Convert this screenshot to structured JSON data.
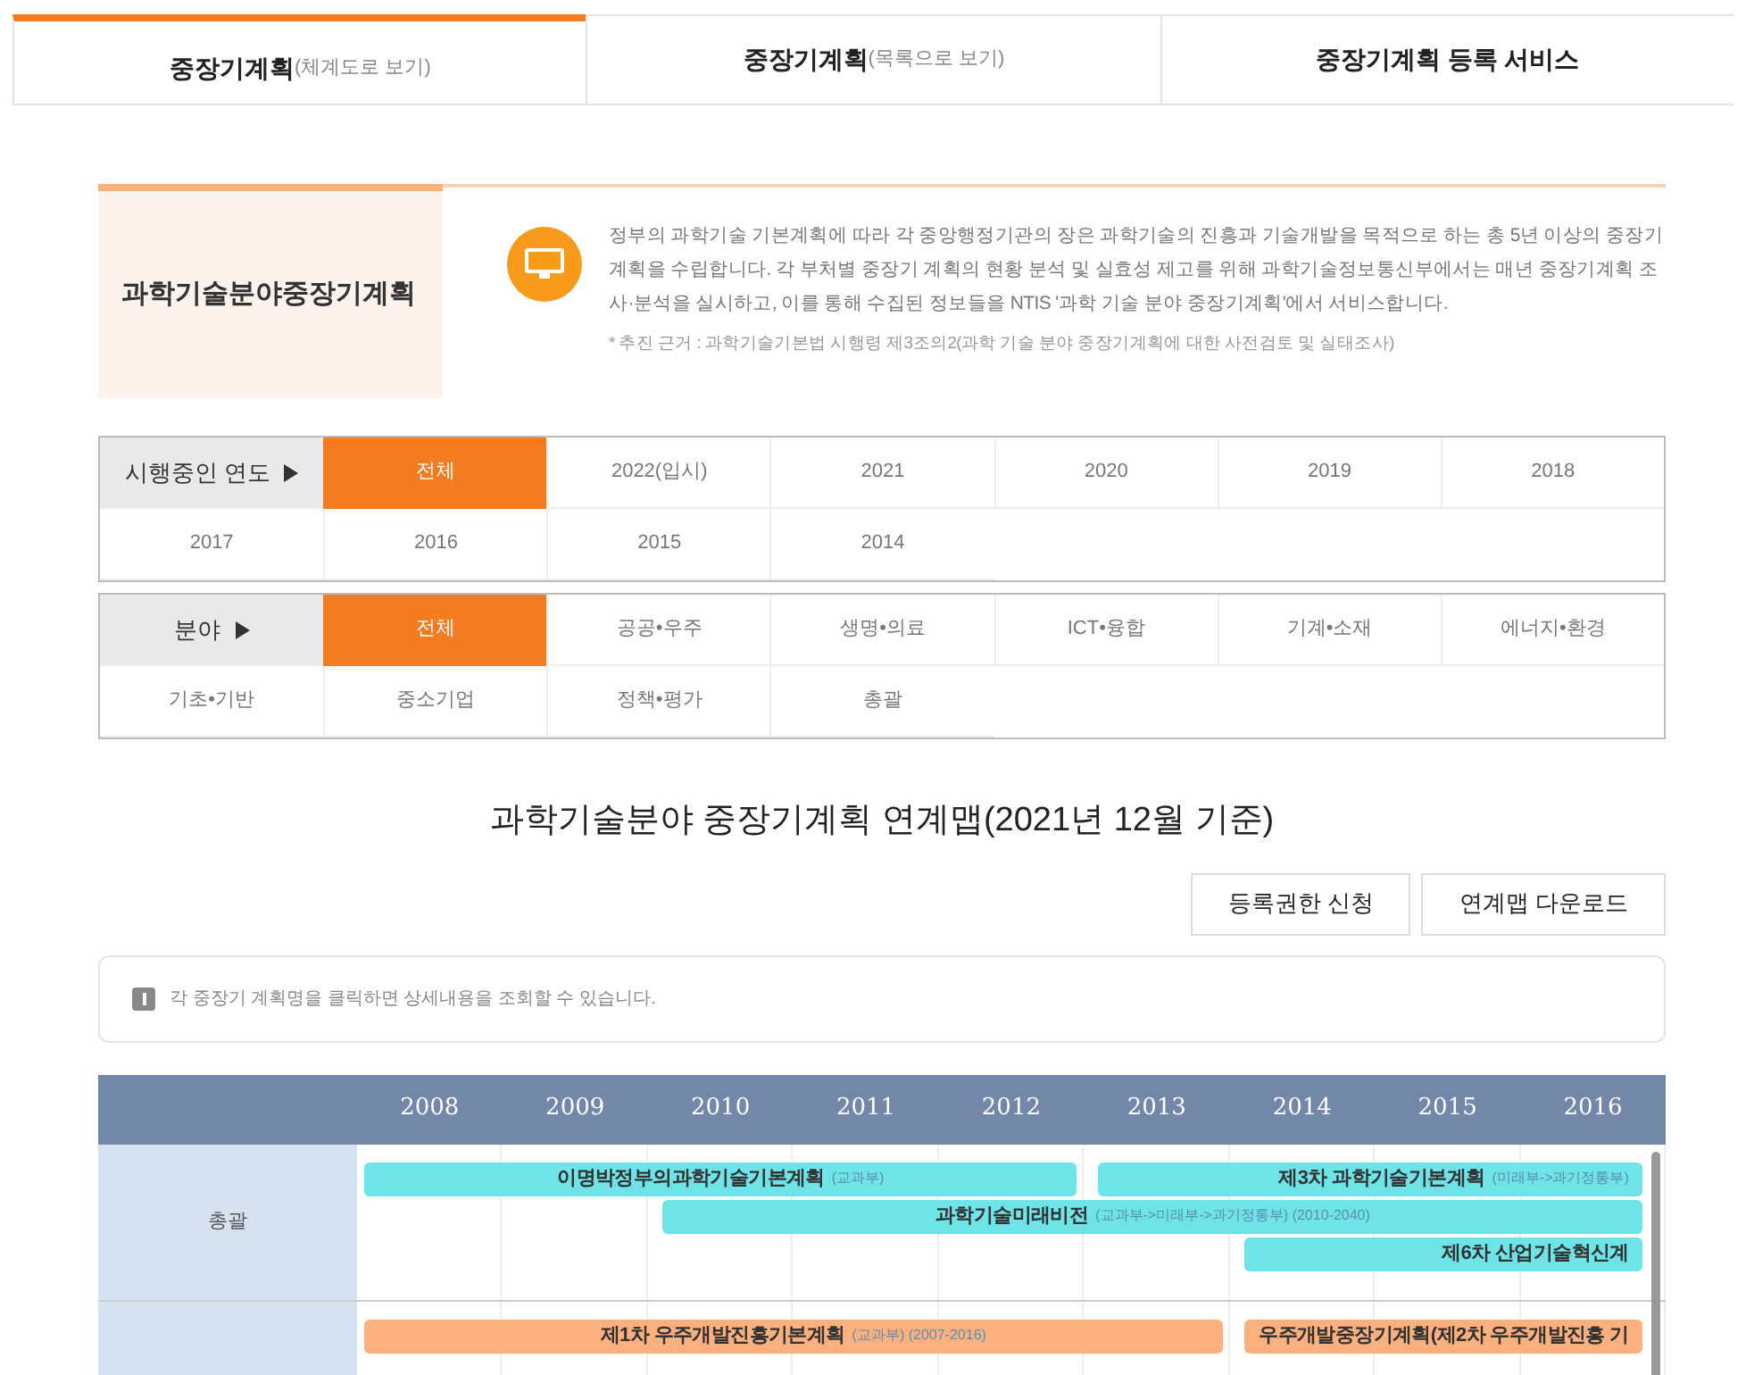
{
  "tabs": [
    {
      "label": "중장기계획",
      "sub": "(체계도로 보기)",
      "selected": true
    },
    {
      "label": "중장기계획",
      "sub": "(목록으로 보기)",
      "selected": false
    },
    {
      "label": "중장기계획 등록 서비스",
      "selected": false
    }
  ],
  "intro": {
    "title": "과학기술분야중장기계획",
    "text": "정부의 과학기술 기본계획에 따라 각 중앙행정기관의 장은 과학기술의 진흥과 기술개발을 목적으로 하는 총 5년 이상의 중장기 계획을 수립합니다. 각 부처별 중장기 계획의 현황 분석 및 실효성 제고를 위해 과학기술정보통신부에서는 매년 중장기계획 조사·분석을 실시하고, 이를 통해 수집된 정보들을 NTIS '과학 기술 분야 중장기계획'에서 서비스합니다.",
    "note": "* 추진 근거 : 과학기술기본법 시행령 제3조의2(과학 기술 분야 중장기계획에 대한 사전검토 및 실태조사)"
  },
  "filters": [
    {
      "label": "시행중인 연도",
      "options": [
        {
          "label": "전체",
          "selected": true
        },
        {
          "label": "2022(입시)",
          "selected": false
        },
        {
          "label": "2021",
          "selected": false
        },
        {
          "label": "2020",
          "selected": false
        },
        {
          "label": "2019",
          "selected": false
        },
        {
          "label": "2018",
          "selected": false
        },
        {
          "label": "2017",
          "selected": false
        },
        {
          "label": "2016",
          "selected": false
        },
        {
          "label": "2015",
          "selected": false
        },
        {
          "label": "2014",
          "selected": false
        }
      ]
    },
    {
      "label": "분야",
      "options": [
        {
          "label": "전체",
          "selected": true
        },
        {
          "label": "공공•우주",
          "selected": false
        },
        {
          "label": "생명•의료",
          "selected": false
        },
        {
          "label": "ICT•융합",
          "selected": false
        },
        {
          "label": "기계•소재",
          "selected": false
        },
        {
          "label": "에너지•환경",
          "selected": false
        },
        {
          "label": "기초•기반",
          "selected": false
        },
        {
          "label": "중소기업",
          "selected": false
        },
        {
          "label": "정책•평가",
          "selected": false
        },
        {
          "label": "총괄",
          "selected": false
        }
      ]
    }
  ],
  "map_title": "과학기술분야 중장기계획 연계맵(2021년 12월 기준)",
  "buttons": [
    "등록권한 신청",
    "연계맵 다운로드"
  ],
  "notice": "각 중장기 계획명을 클릭하면 상세내용을 조회할 수 있습니다.",
  "timeline": {
    "years": [
      "2008",
      "2009",
      "2010",
      "2011",
      "2012",
      "2013",
      "2014",
      "2015",
      "2016"
    ],
    "rows": [
      {
        "label": "총괄",
        "bars": [
          {
            "name": "이명박정부의과학기술기본계획",
            "note": "(교과부)",
            "color": "#6ee3e8"
          },
          {
            "name": "제3차 과학기술기본계획",
            "note": "(미래부->과기정통부)",
            "color": "#6ee3e8"
          },
          {
            "name": "과학기술미래비전",
            "note": "(교과부->미래부->과기정통부) (2010-2040)",
            "color": "#6ee3e8"
          },
          {
            "name": "제6차 산업기술혁신계",
            "color": "#6ee3e8"
          }
        ]
      },
      {
        "label": "",
        "bars": [
          {
            "name": "제1차 우주개발진흥기본계획",
            "note": "(교과부) (2007-2016)",
            "color": "#fbb07e"
          },
          {
            "name": "우주개발중장기계획(제2차 우주개발진흥 기",
            "color": "#fbb07e"
          }
        ]
      }
    ]
  }
}
